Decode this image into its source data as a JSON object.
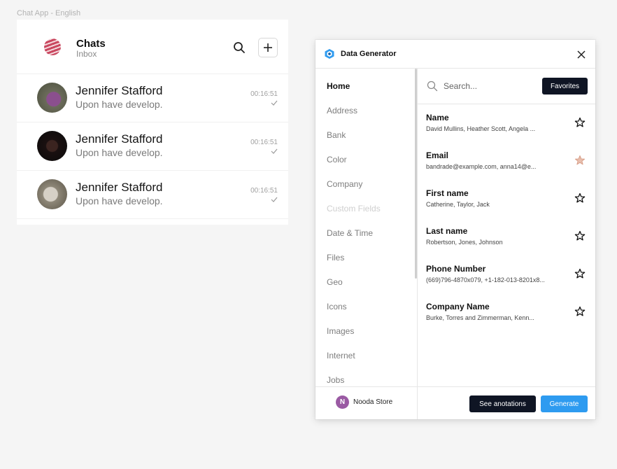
{
  "canvas": {
    "frame_label": "Chat App - English"
  },
  "chat": {
    "title": "Chats",
    "subtitle": "Inbox",
    "rows": [
      {
        "name": "Jennifer Stafford",
        "message": "Upon have develop.",
        "time": "00:16:51"
      },
      {
        "name": "Jennifer Stafford",
        "message": "Upon have develop.",
        "time": "00:16:51"
      },
      {
        "name": "Jennifer Stafford",
        "message": "Upon have develop.",
        "time": "00:16:51"
      }
    ]
  },
  "plugin": {
    "title": "Data Generator",
    "sidebar": {
      "items": [
        {
          "label": "Home",
          "state": "active"
        },
        {
          "label": "Address",
          "state": "normal"
        },
        {
          "label": "Bank",
          "state": "normal"
        },
        {
          "label": "Color",
          "state": "normal"
        },
        {
          "label": "Company",
          "state": "normal"
        },
        {
          "label": "Custom Fields",
          "state": "disabled"
        },
        {
          "label": "Date & Time",
          "state": "normal"
        },
        {
          "label": "Files",
          "state": "normal"
        },
        {
          "label": "Geo",
          "state": "normal"
        },
        {
          "label": "Icons",
          "state": "normal"
        },
        {
          "label": "Images",
          "state": "normal"
        },
        {
          "label": "Internet",
          "state": "normal"
        },
        {
          "label": "Jobs",
          "state": "normal"
        }
      ],
      "footer": {
        "badge": "N",
        "label": "Nooda Store"
      }
    },
    "search": {
      "placeholder": "Search..."
    },
    "favorites_label": "Favorites",
    "fields": [
      {
        "name": "Name",
        "example": "David Mullins, Heather Scott, Angela ...",
        "favorited": false
      },
      {
        "name": "Email",
        "example": "bandrade@example.com, anna14@e...",
        "favorited": true
      },
      {
        "name": "First name",
        "example": "Catherine, Taylor, Jack",
        "favorited": false
      },
      {
        "name": "Last name",
        "example": "Robertson, Jones, Johnson",
        "favorited": false
      },
      {
        "name": "Phone Number",
        "example": "(669)796-4870x079, +1-182-013-8201x8...",
        "favorited": false
      },
      {
        "name": "Company Name",
        "example": "Burke, Torres and Zimmerman, Kenn...",
        "favorited": false
      }
    ],
    "footer": {
      "annotations_label": "See anotations",
      "generate_label": "Generate"
    }
  },
  "colors": {
    "primary_dark": "#0f1524",
    "accent_blue": "#2e9bf0",
    "store_badge": "#9a5aa3",
    "favorite_star": "#d9a08a"
  },
  "icons": [
    "search-icon",
    "plus-icon",
    "check-icon",
    "close-icon",
    "star-icon",
    "plugin-logo-icon"
  ]
}
